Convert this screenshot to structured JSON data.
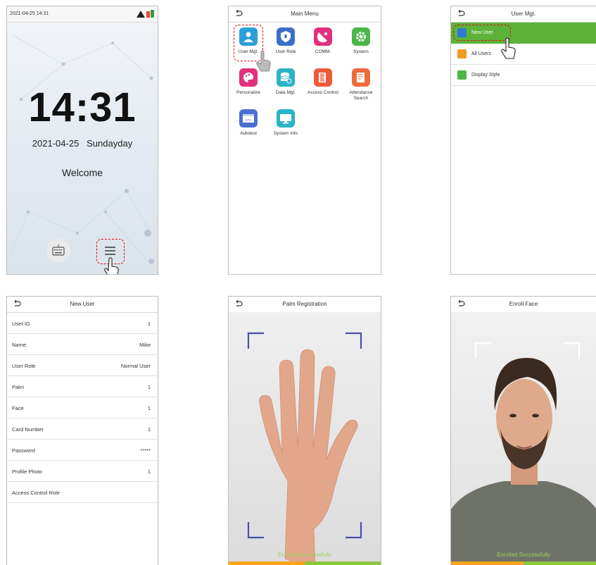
{
  "standby": {
    "status_datetime": "2021-04-25  14:31",
    "clock": "14:31",
    "date": "2021-04-25",
    "weekday": "Sundayday",
    "welcome": "Welcome"
  },
  "main_menu": {
    "title": "Main Menu",
    "items": [
      {
        "label": "User Mgt.",
        "color": "#2a9fd8"
      },
      {
        "label": "User Role",
        "color": "#3b6fc6"
      },
      {
        "label": "COMM.",
        "color": "#e2307e"
      },
      {
        "label": "System",
        "color": "#4cb648"
      },
      {
        "label": "Personalize",
        "color": "#e2307e"
      },
      {
        "label": "Data Mgt.",
        "color": "#2bb3c8"
      },
      {
        "label": "Access Control",
        "color": "#ef5a3a"
      },
      {
        "label": "Attendance Search",
        "color": "#ef6a3a"
      },
      {
        "label": "Autotest",
        "color": "#4a6fd0"
      },
      {
        "label": "System Info",
        "color": "#2bb3c8"
      }
    ]
  },
  "user_mgt": {
    "title": "User Mgt.",
    "items": [
      {
        "label": "New User",
        "color": "#2f7ad8"
      },
      {
        "label": "All Users",
        "color": "#f29a22"
      },
      {
        "label": "Display Style",
        "color": "#4cb648"
      }
    ],
    "accent": "#5cb338"
  },
  "new_user": {
    "title": "New User",
    "rows": [
      {
        "key": "User ID",
        "value": "1"
      },
      {
        "key": "Name",
        "value": "Mike"
      },
      {
        "key": "User Role",
        "value": "Normal User"
      },
      {
        "key": "Palm",
        "value": "1"
      },
      {
        "key": "Face",
        "value": "1"
      },
      {
        "key": "Card Number",
        "value": "1"
      },
      {
        "key": "Password",
        "value": "*****"
      },
      {
        "key": "Profile Photo",
        "value": "1"
      },
      {
        "key": "Access Control Role",
        "value": ""
      }
    ]
  },
  "palm": {
    "title": "Palm Registration",
    "message": "Enrolled Successfully"
  },
  "face": {
    "title": "Enroll Face",
    "message": "Enrolled Successfully"
  }
}
